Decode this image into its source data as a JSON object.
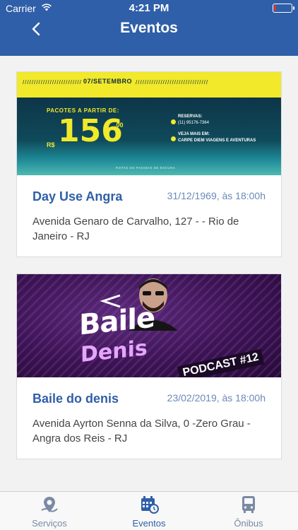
{
  "status_bar": {
    "carrier": "Carrier",
    "time": "4:21 PM"
  },
  "nav": {
    "title": "Eventos"
  },
  "events": [
    {
      "title": "Day Use Angra",
      "date": "31/12/1969, às 18:00h",
      "address": "Avenida Genaro de Carvalho, 127 - - Rio de Janeiro - RJ",
      "banner": {
        "date": "07/SETEMBRO",
        "package_label": "PACOTES A PARTIR DE:",
        "currency": "R$",
        "price": "156",
        "cents": ",00",
        "reservas_label": "RESERVAS:",
        "phone": "(11) 95176-7364",
        "mais_label": "VEJA MAIS EM:",
        "site": "CARPE DIEM VIAGENS E AVENTURAS",
        "footer": "ROTAS DO PASSEIO DE ESCUNA"
      }
    },
    {
      "title": "Baile do denis",
      "date": "23/02/2019, às 18:00h",
      "address": "Avenida Ayrton Senna da Silva, 0 -Zero Grau - Angra dos Reis - RJ",
      "banner": {
        "line1": "Baile",
        "dj": "DJ",
        "line2": "Denis",
        "tag": "PODCAST #12"
      }
    }
  ],
  "tabs": [
    {
      "label": "Serviços",
      "icon": "map-pin-icon",
      "active": false
    },
    {
      "label": "Eventos",
      "icon": "calendar-clock-icon",
      "active": true
    },
    {
      "label": "Ônibus",
      "icon": "bus-icon",
      "active": false
    }
  ],
  "colors": {
    "primary": "#2f5fa8",
    "date_text": "#6a8ab8",
    "tab_inactive": "#7a8aa5"
  }
}
